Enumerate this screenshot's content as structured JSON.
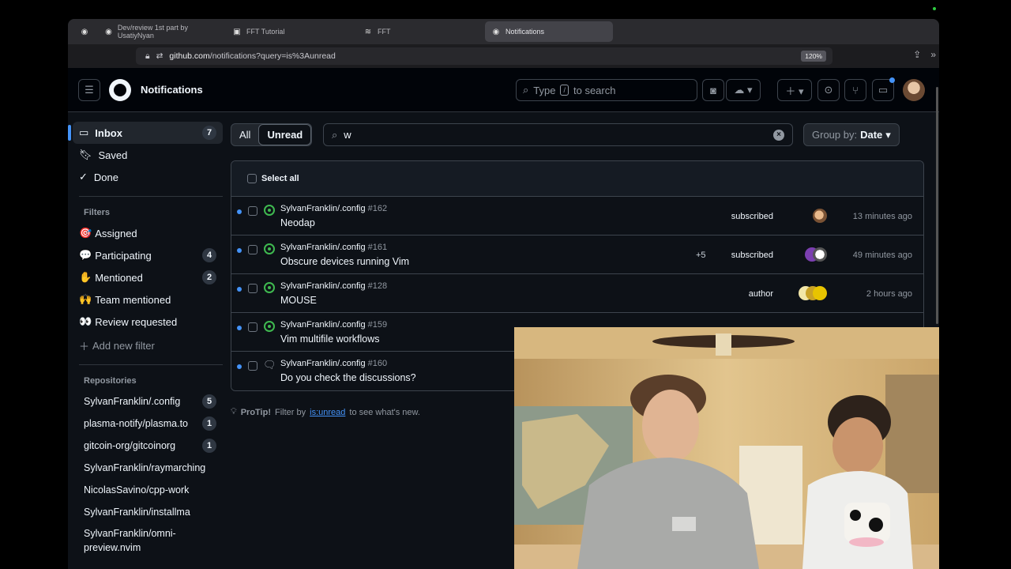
{
  "browser": {
    "tabs": [
      {
        "label": "",
        "icon": "github-icon",
        "active": false
      },
      {
        "label": "Dev/review 1st part by UsatiyNyan",
        "icon": "github-icon",
        "active": false
      },
      {
        "label": "FFT Tutorial",
        "icon": "image-icon",
        "active": false
      },
      {
        "label": "FFT",
        "icon": "wave-icon",
        "active": false
      },
      {
        "label": "Notifications",
        "icon": "github-icon",
        "active": true
      }
    ],
    "url_host": "github.com",
    "url_path": "/notifications?query=is%3Aunread",
    "zoom": "120%"
  },
  "header": {
    "title": "Notifications",
    "search_prefix": "Type",
    "search_key": "/",
    "search_suffix": "to search"
  },
  "sidebar": {
    "main": [
      {
        "label": "Inbox",
        "count": "7",
        "icon": "inbox-icon",
        "active": true
      },
      {
        "label": "Saved",
        "count": "",
        "icon": "bookmark-icon",
        "active": false
      },
      {
        "label": "Done",
        "count": "",
        "icon": "check-icon",
        "active": false
      }
    ],
    "filters_label": "Filters",
    "filters": [
      {
        "label": "Assigned",
        "emoji": "🎯",
        "count": ""
      },
      {
        "label": "Participating",
        "emoji": "💬",
        "count": "4"
      },
      {
        "label": "Mentioned",
        "emoji": "✋",
        "count": "2"
      },
      {
        "label": "Team mentioned",
        "emoji": "🙌",
        "count": ""
      },
      {
        "label": "Review requested",
        "emoji": "👀",
        "count": ""
      }
    ],
    "add_filter": "Add new filter",
    "repos_label": "Repositories",
    "repos": [
      {
        "label": "SylvanFranklin/.config",
        "count": "5"
      },
      {
        "label": "plasma-notify/plasma.to",
        "count": "1"
      },
      {
        "label": "gitcoin-org/gitcoinorg",
        "count": "1"
      },
      {
        "label": "SylvanFranklin/raymarching",
        "count": ""
      },
      {
        "label": "NicolasSavino/cpp-work",
        "count": ""
      },
      {
        "label": "SylvanFranklin/installma",
        "count": ""
      },
      {
        "label": "SylvanFranklin/omni-",
        "count": ""
      },
      {
        "label": "preview.nvim",
        "count": ""
      }
    ]
  },
  "toolbar": {
    "all_label": "All",
    "unread_label": "Unread",
    "filter_value": "w",
    "group_by_label": "Group by:",
    "group_by_value": "Date"
  },
  "list": {
    "select_all": "Select all",
    "rows": [
      {
        "repo": "SylvanFranklin/.config",
        "num": "#162",
        "title": "Neodap",
        "extra": "",
        "reason": "subscribed",
        "time": "13 minutes ago",
        "type": "issue"
      },
      {
        "repo": "SylvanFranklin/.config",
        "num": "#161",
        "title": "Obscure devices running Vim",
        "extra": "+5",
        "reason": "subscribed",
        "time": "49 minutes ago",
        "type": "issue"
      },
      {
        "repo": "SylvanFranklin/.config",
        "num": "#128",
        "title": "MOUSE",
        "extra": "",
        "reason": "author",
        "time": "2 hours ago",
        "type": "issue"
      },
      {
        "repo": "SylvanFranklin/.config",
        "num": "#159",
        "title": "Vim multifile workflows",
        "extra": "",
        "reason": "",
        "time": "",
        "type": "issue"
      },
      {
        "repo": "SylvanFranklin/.config",
        "num": "#160",
        "title": "Do you check the discussions?",
        "extra": "",
        "reason": "",
        "time": "",
        "type": "discussion"
      }
    ]
  },
  "protip": {
    "label": "ProTip!",
    "before": "Filter by",
    "link": "is:unread",
    "after": "to see what's new."
  },
  "colors": {
    "accent": "#4493f8",
    "open_issue": "#3fb950",
    "bg": "#0d1117"
  }
}
